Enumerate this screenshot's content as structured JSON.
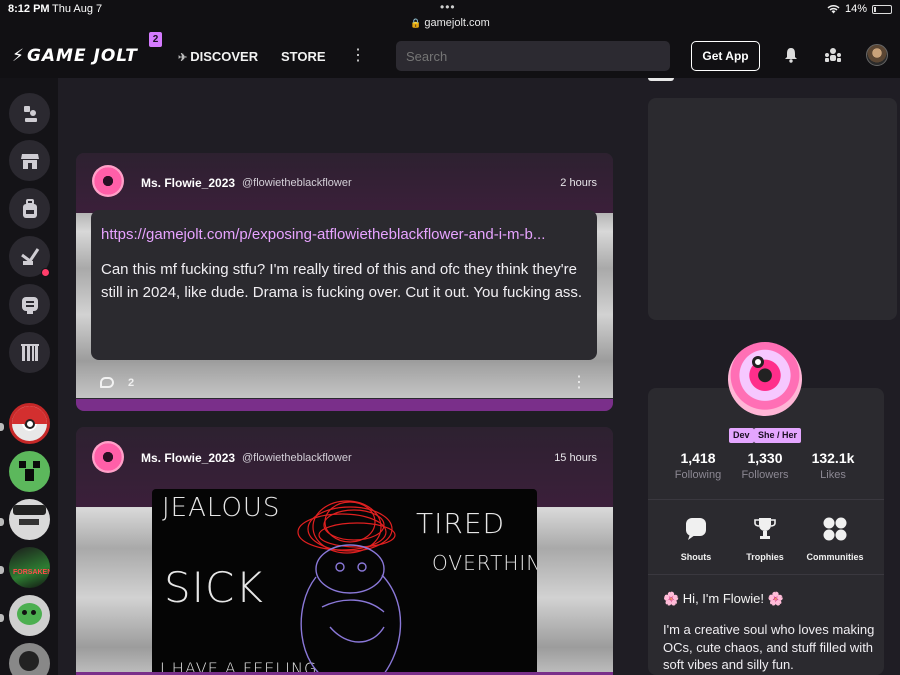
{
  "status_bar": {
    "time": "8:12 PM",
    "date": "Thu Aug 7",
    "url": "gamejolt.com",
    "battery": "14%",
    "battery_level": 0.14
  },
  "topnav": {
    "logo": "GAME JOLT",
    "logo_badge": "2",
    "discover": "DISCOVER",
    "store": "STORE",
    "search_placeholder": "Search",
    "get_app": "Get App"
  },
  "sidebar": {
    "items": [
      {
        "icon": "person-podium-icon"
      },
      {
        "icon": "store-icon"
      },
      {
        "icon": "backpack-icon"
      },
      {
        "icon": "quest-icon",
        "has_notification": true
      },
      {
        "icon": "chat-icon"
      },
      {
        "icon": "library-icon"
      }
    ],
    "communities": [
      "pokeball",
      "creeper",
      "hat-guy",
      "forsaken",
      "green-robot",
      "skull"
    ]
  },
  "posts": [
    {
      "author": "Ms. Flowie_2023",
      "handle": "@flowietheblackflower",
      "time": "2 hours",
      "link": "https://gamejolt.com/p/exposing-atflowietheblackflower-and-i-m-b...",
      "text": "Can this mf fucking stfu? I'm really tired of this and ofc they think they're still in 2024, like dude. Drama is fucking over. Cut it out. You fucking ass.",
      "comments": "2"
    },
    {
      "author": "Ms. Flowie_2023",
      "handle": "@flowietheblackflower",
      "time": "15 hours",
      "drawing_words": [
        "JEALOUS",
        "TIRED",
        "SICK",
        "OVERTHINKIN",
        "I HAVE A FEELING"
      ]
    }
  ],
  "profile": {
    "tags": [
      "Dev",
      "She / Her"
    ],
    "stats": [
      {
        "value": "1,418",
        "label": "Following"
      },
      {
        "value": "1,330",
        "label": "Followers"
      },
      {
        "value": "132.1k",
        "label": "Likes"
      }
    ],
    "actions": [
      {
        "label": "Shouts",
        "icon": "shout-bubble-icon"
      },
      {
        "label": "Trophies",
        "icon": "trophy-icon"
      },
      {
        "label": "Communities",
        "icon": "communities-icon"
      }
    ],
    "bio_title": "🌸 Hi, I'm Flowie! 🌸",
    "bio_text": "I'm a creative soul who loves making OCs, cute chaos, and stuff filled with soft vibes and silly fun."
  },
  "colors": {
    "accent": "#d57bff",
    "link": "#e7a3ff",
    "notification": "#ff3d6a",
    "post_bar": "#7a2f8a"
  }
}
